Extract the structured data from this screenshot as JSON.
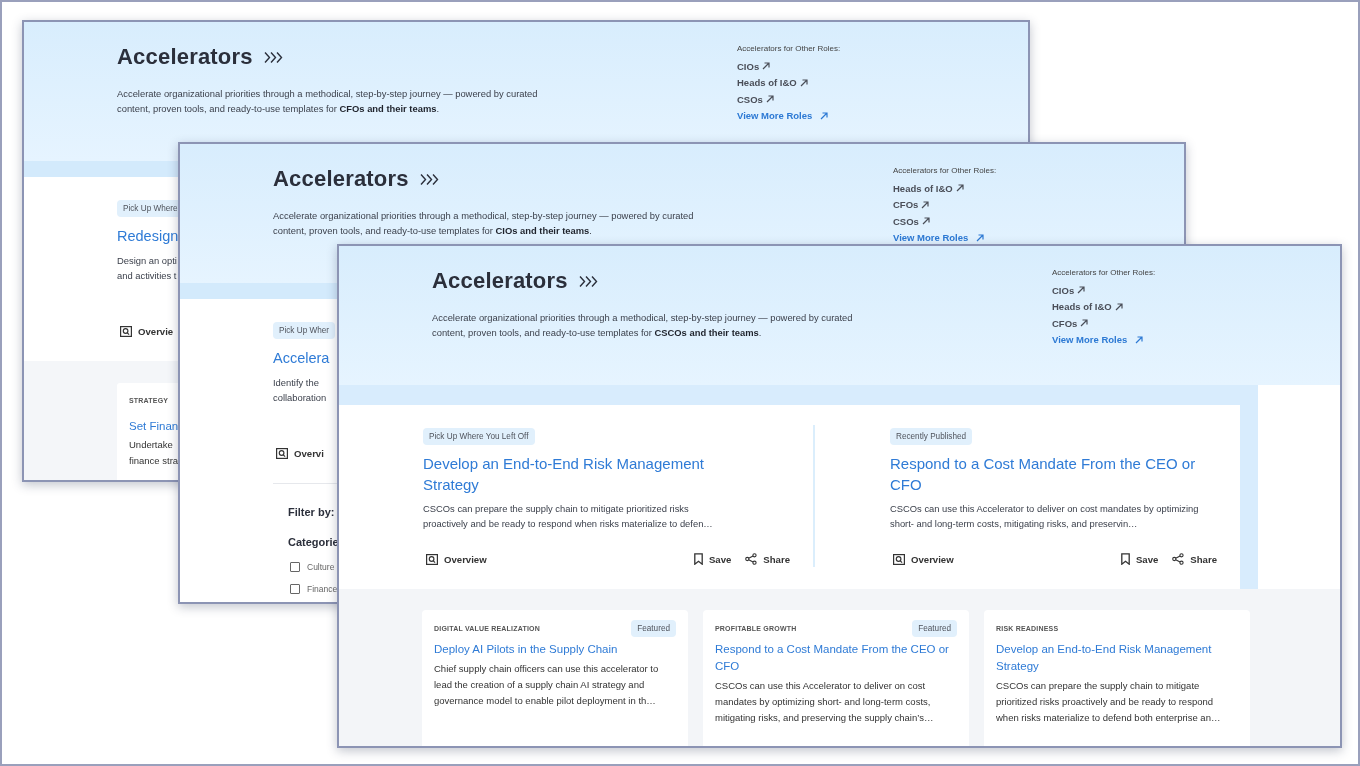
{
  "windows": [
    {
      "kind": "back",
      "header": {
        "title": "Accelerators",
        "description": "Accelerate organizational priorities through a methodical, step-by-step journey — powered by curated content, proven tools, and ready-to-use templates for **CFOs and their teams**.",
        "roles_label": "Accelerators for Other Roles:",
        "roles": [
          "CIOs",
          "Heads of I&O",
          "CSOs"
        ],
        "more_roles": "View More Roles"
      },
      "feature": {
        "badge": "Pick Up Where",
        "title": "Redesign",
        "description_lines": [
          "Design an opti",
          "and activities t"
        ],
        "overview": "Overvie"
      },
      "lower": {
        "kind": "card",
        "category": "STRATEGY",
        "title": "Set Finan",
        "description_lines": [
          "Undertake",
          "finance stra"
        ]
      }
    },
    {
      "kind": "back",
      "header": {
        "title": "Accelerators",
        "description": "Accelerate organizational priorities through a methodical, step-by-step journey — powered by curated content, proven tools, and ready-to-use templates for **CIOs and their teams**.",
        "roles_label": "Accelerators for Other Roles:",
        "roles": [
          "Heads of I&O",
          "CFOs",
          "CSOs"
        ],
        "more_roles": "View More Roles"
      },
      "feature": {
        "badge": "Pick Up Wher",
        "title": "Accelera",
        "description_lines": [
          "Identify the",
          "collaboration"
        ],
        "overview": "Overvi"
      },
      "lower": {
        "kind": "filters",
        "heading": "Filter by:",
        "group": "Categorie",
        "options": [
          {
            "label": "Culture",
            "checked": false
          },
          {
            "label": "Finance",
            "checked": false
          }
        ]
      }
    },
    {
      "kind": "front",
      "header": {
        "title": "Accelerators",
        "description": "Accelerate organizational priorities through a methodical, step-by-step journey — powered by curated content, proven tools, and ready-to-use templates for **CSCOs and their teams**.",
        "roles_label": "Accelerators for Other Roles:",
        "roles": [
          "CIOs",
          "Heads of I&O",
          "CFOs"
        ],
        "more_roles": "View More Roles"
      },
      "features": [
        {
          "badge": "Pick Up Where You Left Off",
          "title": "Develop an End-to-End Risk Management Strategy",
          "description": "CSCOs can prepare the supply chain to mitigate prioritized risks proactively and be ready to respond when risks materialize to defen…",
          "overview": "Overview",
          "save": "Save",
          "share": "Share"
        },
        {
          "badge": "Recently Published",
          "title": "Respond to a Cost Mandate From the CEO or CFO",
          "description": "CSCOs can use this Accelerator to deliver on cost mandates by optimizing short- and long-term costs, mitigating risks, and preservin…",
          "overview": "Overview",
          "save": "Save",
          "share": "Share"
        }
      ],
      "cards": [
        {
          "category": "DIGITAL VALUE REALIZATION",
          "badge": "Featured",
          "title": "Deploy AI Pilots in the Supply Chain",
          "description": "Chief supply chain officers can use this accelerator to lead the creation of a supply chain AI strategy and governance model to enable pilot deployment in th…"
        },
        {
          "category": "PROFITABLE GROWTH",
          "badge": "Featured",
          "title": "Respond to a Cost Mandate From the CEO or CFO",
          "description": "CSCOs can use this Accelerator to deliver on cost mandates by optimizing short- and long-term costs, mitigating risks, and preserving the supply chain’s…"
        },
        {
          "category": "RISK READINESS",
          "title": "Develop an End-to-End Risk Management Strategy",
          "description": "CSCOs can prepare the supply chain to mitigate prioritized risks proactively and be ready to respond when risks materialize to defend both enterprise an…"
        }
      ]
    }
  ]
}
